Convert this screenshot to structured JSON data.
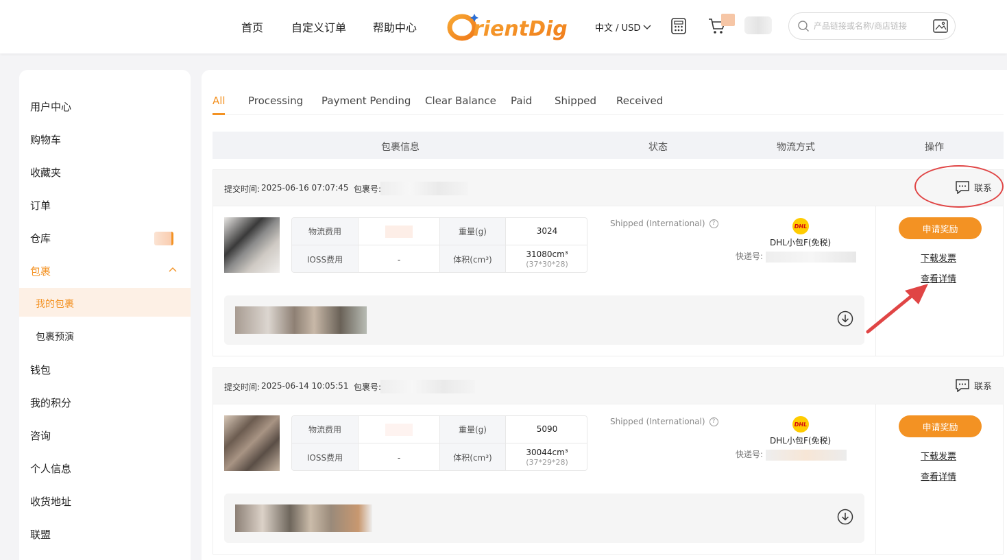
{
  "header": {
    "nav": [
      "首页",
      "自定义订单",
      "帮助中心"
    ],
    "logo_text": "OrientDig",
    "lang": "中文 / USD",
    "search_placeholder": "产品链接或名称/商店链接"
  },
  "sidebar": {
    "items": [
      "用户中心",
      "购物车",
      "收藏夹",
      "订单",
      "仓库",
      "包裹",
      "钱包",
      "我的积分",
      "咨询",
      "个人信息",
      "收货地址",
      "联盟"
    ],
    "sub_items": [
      "我的包裹",
      "包裹预演"
    ],
    "active": "包裹",
    "active_sub": "我的包裹"
  },
  "tabs": [
    "All",
    "Processing",
    "Payment Pending",
    "Clear Balance",
    "Paid",
    "Shipped",
    "Received"
  ],
  "active_tab": "All",
  "table_header": [
    "包裹信息",
    "状态",
    "物流方式",
    "操作"
  ],
  "packages": [
    {
      "submit_label": "提交时间:",
      "submit_time": "2025-06-16 07:07:45",
      "pkg_no_label": "包裹号:",
      "contact": "联系",
      "fee_labels": [
        "物流费用",
        "IOSS费用"
      ],
      "ioss_value": "-",
      "weight_label": "重量(g)",
      "weight": "3024",
      "volume_label": "体积(cm³)",
      "volume": "31080cm³",
      "dims": "(37*30*28)",
      "status": "Shipped (International)",
      "carrier": "DHL小包F(免税)",
      "tracking_label": "快递号:",
      "btn_reward": "申请奖励",
      "link_invoice": "下载发票",
      "link_detail": "查看详情"
    },
    {
      "submit_label": "提交时间:",
      "submit_time": "2025-06-14 10:05:51",
      "pkg_no_label": "包裹号:",
      "contact": "联系",
      "fee_labels": [
        "物流费用",
        "IOSS费用"
      ],
      "ioss_value": "-",
      "weight_label": "重量(g)",
      "weight": "5090",
      "volume_label": "体积(cm³)",
      "volume": "30044cm³",
      "dims": "(37*29*28)",
      "status": "Shipped (International)",
      "carrier": "DHL小包F(免税)",
      "tracking_label": "快递号:",
      "btn_reward": "申请奖励",
      "link_invoice": "下载发票",
      "link_detail": "查看详情"
    }
  ],
  "colors": {
    "accent": "#f39223",
    "annotation": "#e04545"
  }
}
